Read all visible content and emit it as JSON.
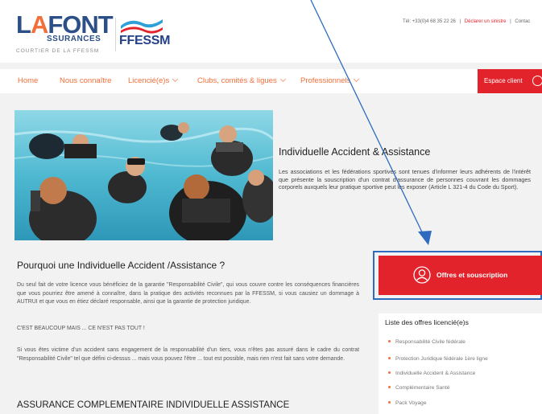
{
  "header": {
    "brand_main": "FONT",
    "brand_a": "A",
    "brand_l": "L",
    "brand_sub": "SSURANCES",
    "brand_tagline": "COURTIER DE LA FFESSM",
    "partner_logo": "FFESSM",
    "phone": "Tél: +33(0)4 68 35 22 26",
    "sep1": "|",
    "declare_link": "Déclarer un sinistre",
    "sep2": "|",
    "contact_link": "Contac"
  },
  "nav": {
    "items": [
      {
        "label": "Home",
        "has_chevron": false
      },
      {
        "label": "Nous connaître",
        "has_chevron": false
      },
      {
        "label": "Licencié(e)s",
        "has_chevron": true
      },
      {
        "label": "Clubs, comités & ligues",
        "has_chevron": true
      },
      {
        "label": "Professionnels",
        "has_chevron": true
      }
    ],
    "client_button": "Espace client",
    "client_icon": "user-circle-icon"
  },
  "hero": {
    "image": "scuba-divers-pool-photo",
    "title": "Individuelle Accident & Assistance",
    "text": "Les associations et les fédérations sportives sont tenues d'informer leurs adhérents de l'intérêt que présente la souscription d'un contrat d'assurance de personnes couvrant les dommages corporels auxquels leur pratique sportive peut les exposer (Article L 321-4 du Code du Sport)."
  },
  "main": {
    "why_title": "Pourquoi une Individuelle Accident /Assistance ?",
    "para1": "Du seul fait de votre licence vous bénéficiez de la garantie \"Responsabilité Civile\", qui vous couvre contre les conséquences financières que vous pourriez être amené à connaître, dans la pratique des activités reconnues par la FFESSM, si vous causiez un dommage à AUTRUI et que vous en étiez déclaré responsable, ainsi que la garantie de protection juridique.",
    "para2": "C'EST BEAUCOUP MAIS ... CE N'EST PAS TOUT !",
    "para3": "Si vous êtes victime d'un accident sans engagement de la responsabilité d'un tiers, vous n'êtes pas assuré dans le cadre du contrat \"Responsabilité Civile\" tel que défini ci-dessus ... mais vous pouvez l'être ... tout est possible, mais rien n'est fait sans votre demande.",
    "comp_title": "ASSURANCE COMPLEMENTAIRE INDIVIDUELLE ASSISTANCE"
  },
  "sidebar": {
    "offers_button": "Offres et souscription",
    "offers_icon": "user-circle-icon",
    "list_title": "Liste des offres licencié(e)s",
    "list_items": [
      "Responsabilité Civile fédérale",
      "Protection Juridique fédérale 1ère ligne",
      "Individuelle Accident & Assistance",
      "Complémentaire Santé",
      "Pack Voyage"
    ]
  },
  "colors": {
    "accent_red": "#e3232b",
    "nav_orange": "#f26f3a",
    "brand_blue": "#2b4f86",
    "annotation_blue": "#2e6bbf"
  }
}
